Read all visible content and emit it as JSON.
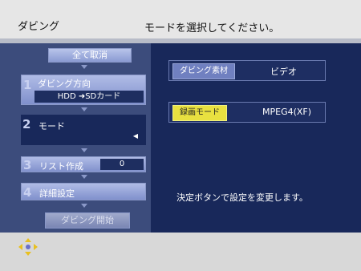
{
  "header": {
    "title": "ダビング",
    "prompt": "モードを選択してください。"
  },
  "left_menu": {
    "cancel_all": "全て取消",
    "items": [
      {
        "num": "1",
        "label": "ダビング方向",
        "value": "HDD   ➜SDカード"
      },
      {
        "num": "2",
        "label": "モード",
        "caret": "◀"
      },
      {
        "num": "3",
        "label": "リスト作成",
        "value": "0"
      },
      {
        "num": "4",
        "label": "詳細設定"
      }
    ],
    "start": "ダビング開始"
  },
  "right_panel": {
    "source_tag": "ダビング素材",
    "source_value": "ビデオ",
    "mode_tag": "録画モード",
    "mode_value": "MPEG4(XF)",
    "message": "決定ボタンで設定を変更します。"
  },
  "colors": {
    "highlight": "#e8e040",
    "panel": "#18285a"
  },
  "icons": {
    "dpad": "dpad-icon"
  }
}
